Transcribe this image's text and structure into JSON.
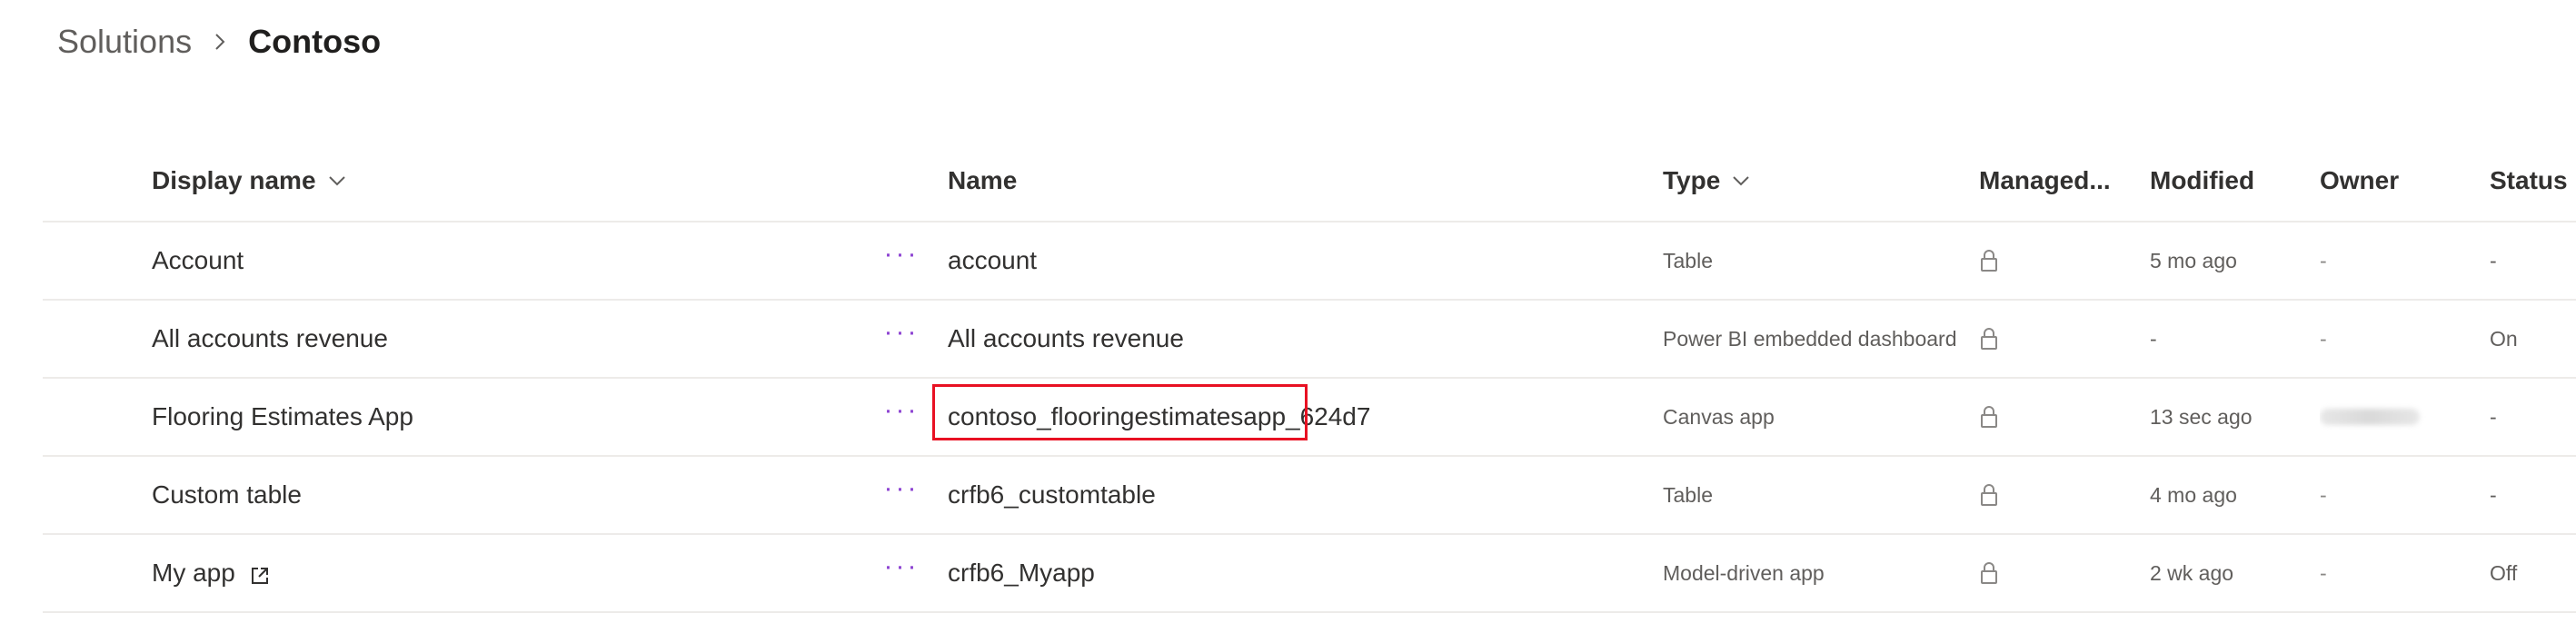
{
  "breadcrumb": {
    "parent": "Solutions",
    "current": "Contoso"
  },
  "columns": {
    "display_name": "Display name",
    "name": "Name",
    "type": "Type",
    "managed": "Managed...",
    "modified": "Modified",
    "owner": "Owner",
    "status": "Status"
  },
  "more_label": "···",
  "rows": [
    {
      "display_name": "Account",
      "name": "account",
      "type": "Table",
      "modified": "5 mo ago",
      "owner": "-",
      "status": "-"
    },
    {
      "display_name": "All accounts revenue",
      "name": "All accounts revenue",
      "type": "Power BI embedded dashboard",
      "modified": "-",
      "owner": "-",
      "status": "On"
    },
    {
      "display_name": "Flooring Estimates App",
      "name": "contoso_flooringestimatesapp_624d7",
      "type": "Canvas app",
      "modified": "13 sec ago",
      "owner": "",
      "status": "-"
    },
    {
      "display_name": "Custom table",
      "name": "crfb6_customtable",
      "type": "Table",
      "modified": "4 mo ago",
      "owner": "-",
      "status": "-"
    },
    {
      "display_name": "My app",
      "name": "crfb6_Myapp",
      "type": "Model-driven app",
      "modified": "2 wk ago",
      "owner": "-",
      "status": "Off"
    }
  ],
  "icons": {
    "breadcrumb_separator": "chevron-right-icon",
    "sort": "chevron-down-icon",
    "managed": "lock-icon",
    "external": "open-in-new-window-icon"
  },
  "colors": {
    "accent": "#8a3fd1",
    "highlight": "#e81123",
    "divider": "#edebe9"
  }
}
